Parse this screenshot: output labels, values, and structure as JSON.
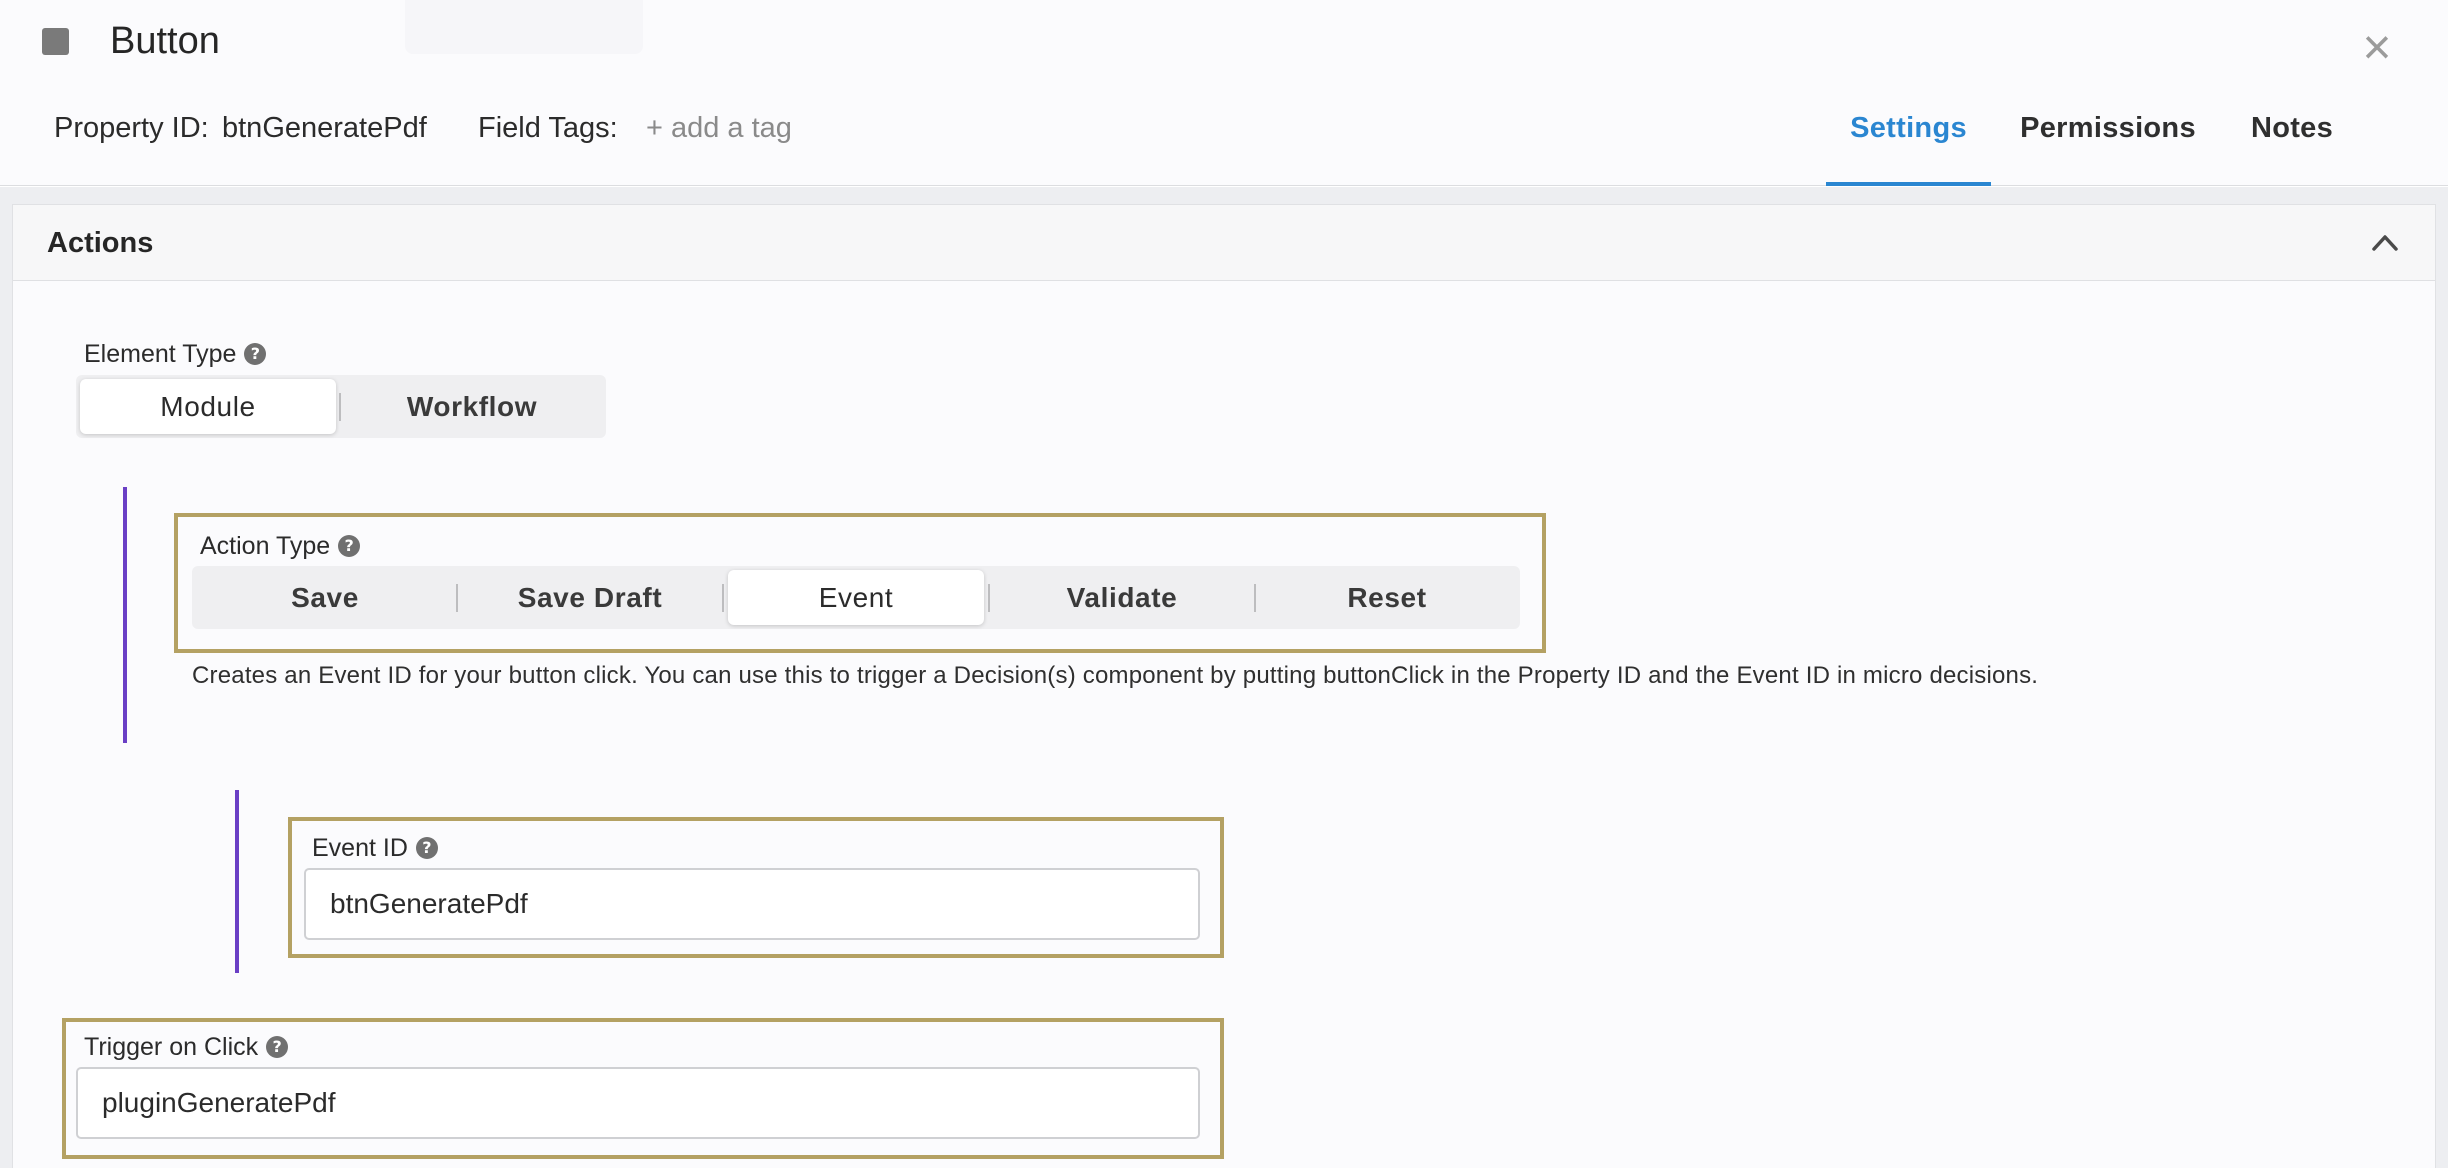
{
  "header": {
    "title": "Button",
    "property_id_label": "Property ID:",
    "property_id_value": "btnGeneratePdf",
    "field_tags_label": "Field Tags:",
    "add_tag_label": "+ add a tag",
    "close_glyph": "×"
  },
  "tabs": [
    {
      "label": "Settings",
      "active": true
    },
    {
      "label": "Permissions",
      "active": false
    },
    {
      "label": "Notes",
      "active": false
    }
  ],
  "panel": {
    "title": "Actions",
    "element_type": {
      "label": "Element Type",
      "options": [
        "Module",
        "Workflow"
      ],
      "selected": "Module"
    },
    "action_type": {
      "label": "Action Type",
      "options": [
        "Save",
        "Save Draft",
        "Event",
        "Validate",
        "Reset"
      ],
      "selected": "Event",
      "description": "Creates an Event ID for your button click. You can use this to trigger a Decision(s) component by putting buttonClick in the Property ID and the Event ID in micro decisions."
    },
    "event_id": {
      "label": "Event ID",
      "value": "btnGeneratePdf"
    },
    "trigger_on_click": {
      "label": "Trigger on Click",
      "value": "pluginGeneratePdf"
    }
  },
  "colors": {
    "accent": "#2a86d1",
    "nesting_line": "#6a3fc5",
    "highlight_border": "#b4a163"
  },
  "icons": {
    "help": "?"
  }
}
